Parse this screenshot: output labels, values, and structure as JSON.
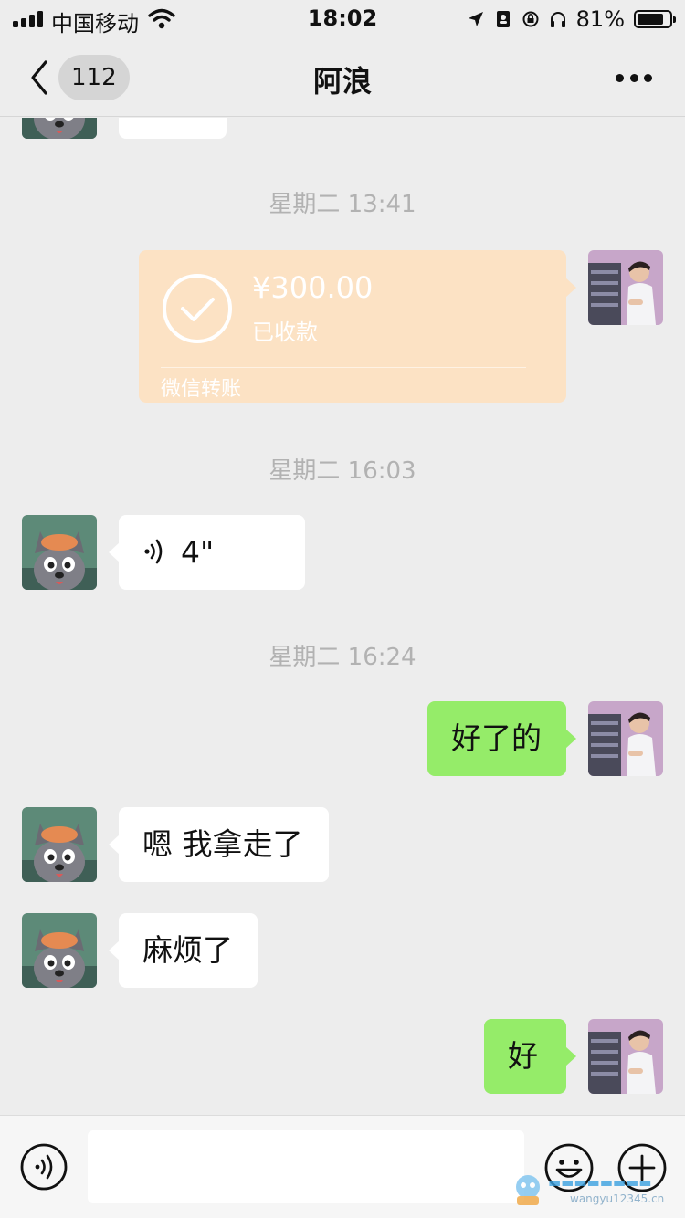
{
  "status_bar": {
    "carrier": "中国移动",
    "time": "18:02",
    "battery_percent": "81%",
    "battery_level": 0.81
  },
  "nav": {
    "unread_count": "112",
    "title": "阿浪",
    "back_icon": "chevron-left-icon",
    "more_icon": "more-dots-icon"
  },
  "messages": {
    "timestamps": [
      "星期二 13:41",
      "星期二 16:03",
      "星期二 16:24"
    ],
    "transfer": {
      "amount": "¥300.00",
      "status": "已收款",
      "footer": "微信转账"
    },
    "voice": {
      "duration": "4\""
    },
    "texts": [
      "好了的",
      "嗯 我拿走了",
      "麻烦了",
      "好"
    ]
  },
  "input_bar": {
    "text_value": "",
    "voice_icon": "voice-icon",
    "emoji_icon": "emoji-icon",
    "plus_icon": "plus-icon"
  },
  "watermark": {
    "line2": "wangyu12345.cn"
  },
  "colors": {
    "background": "#ededed",
    "outgoing_bubble": "#95ec69",
    "incoming_bubble": "#ffffff",
    "transfer_card": "#fce2c4",
    "timestamp": "#b2b2b2"
  }
}
